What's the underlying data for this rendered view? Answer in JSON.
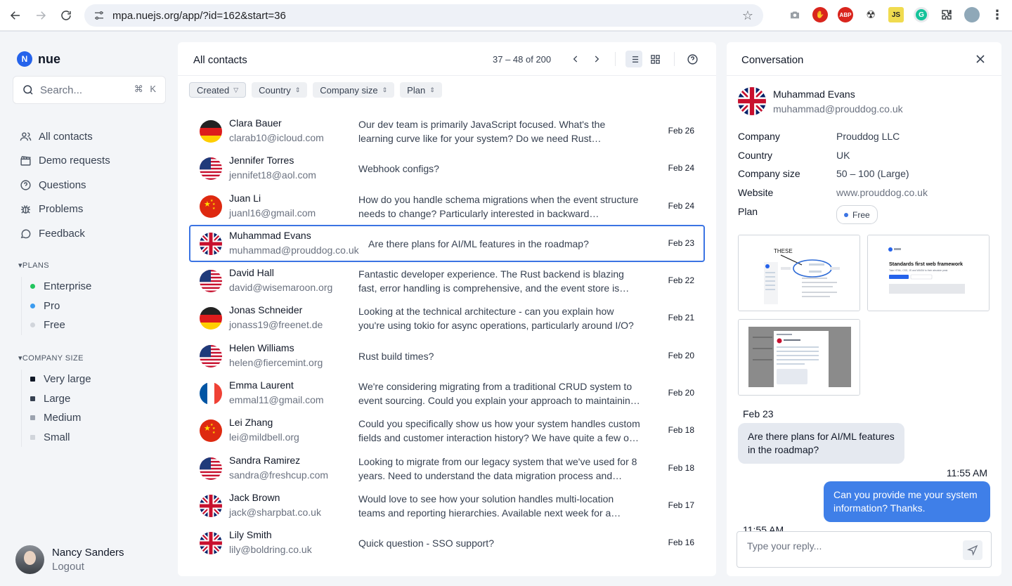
{
  "browser": {
    "url": "mpa.nuejs.org/app/?id=162&start=36"
  },
  "app": {
    "brand": "nue",
    "brand_logo_letter": "N",
    "search": {
      "placeholder": "Search...",
      "shortcut": "⌘ K"
    },
    "nav": [
      {
        "label": "All contacts",
        "icon": "users-icon"
      },
      {
        "label": "Demo requests",
        "icon": "clapperboard-icon"
      },
      {
        "label": "Questions",
        "icon": "question-circle-icon"
      },
      {
        "label": "Problems",
        "icon": "bug-icon"
      },
      {
        "label": "Feedback",
        "icon": "chat-bubble-icon"
      }
    ],
    "plans": {
      "title": "PLANS",
      "items": [
        {
          "label": "Enterprise",
          "color": "#22c55e"
        },
        {
          "label": "Pro",
          "color": "#3b9cf0"
        },
        {
          "label": "Free",
          "color": "#d1d5db"
        }
      ]
    },
    "company_size": {
      "title": "COMPANY SIZE",
      "items": [
        {
          "label": "Very large",
          "color": "#111827"
        },
        {
          "label": "Large",
          "color": "#374151"
        },
        {
          "label": "Medium",
          "color": "#9ca3af"
        },
        {
          "label": "Small",
          "color": "#d1d5db"
        }
      ]
    },
    "user": {
      "name": "Nancy Sanders",
      "logout": "Logout"
    }
  },
  "list": {
    "title": "All contacts",
    "pager": "37 – 48 of 200",
    "filters": [
      "Created",
      "Country",
      "Company size",
      "Plan"
    ],
    "contacts": [
      {
        "name": "Clara Bauer",
        "email": "clarab10@icloud.com",
        "flag": "de",
        "message": "Our dev team is primarily JavaScript focused. What's the learning curve like for your system? Do we need Rust knowledge?",
        "date": "Feb 26"
      },
      {
        "name": "Jennifer Torres",
        "email": "jennifet18@aol.com",
        "flag": "us",
        "message": "Webhook configs?",
        "date": "Feb 24"
      },
      {
        "name": "Juan Li",
        "email": "juanl16@gmail.com",
        "flag": "cn",
        "message": "How do you handle schema migrations when the event structure needs to change? Particularly interested in backward compatibility.",
        "date": "Feb 24"
      },
      {
        "name": "Muhammad Evans",
        "email": "muhammad@prouddog.co.uk",
        "flag": "uk",
        "message": "Are there plans for AI/ML features in the roadmap?",
        "date": "Feb 23",
        "selected": true
      },
      {
        "name": "David Hall",
        "email": "david@wisemaroon.org",
        "flag": "us",
        "message": "Fantastic developer experience. The Rust backend is blazing fast, error handling is comprehensive, and the event store is solid.",
        "date": "Feb 22"
      },
      {
        "name": "Jonas Schneider",
        "email": "jonass19@freenet.de",
        "flag": "de",
        "message": "Looking at the technical architecture - can you explain how you're using tokio for async operations, particularly around I/O?",
        "date": "Feb 21"
      },
      {
        "name": "Helen Williams",
        "email": "helen@fiercemint.org",
        "flag": "us",
        "message": "Rust build times?",
        "date": "Feb 20"
      },
      {
        "name": "Emma Laurent",
        "email": "emmal11@gmail.com",
        "flag": "fr",
        "message": "We're considering migrating from a traditional CRUD system to event sourcing. Could you explain your approach to maintaining consistency?",
        "date": "Feb 20"
      },
      {
        "name": "Lei Zhang",
        "email": "lei@mildbell.org",
        "flag": "cn",
        "message": "Could you specifically show us how your system handles custom fields and customer interaction history? We have quite a few of those.",
        "date": "Feb 18"
      },
      {
        "name": "Sandra Ramirez",
        "email": "sandra@freshcup.com",
        "flag": "us",
        "message": "Looking to migrate from our legacy system that we've used for 8 years. Need to understand the data migration process and timeline.",
        "date": "Feb 18"
      },
      {
        "name": "Jack Brown",
        "email": "jack@sharpbat.co.uk",
        "flag": "uk",
        "message": "Would love to see how your solution handles multi-location teams and reporting hierarchies. Available next week for a demo.",
        "date": "Feb 17"
      },
      {
        "name": "Lily Smith",
        "email": "lily@boldring.co.uk",
        "flag": "uk",
        "message": "Quick question - SSO support?",
        "date": "Feb 16"
      }
    ]
  },
  "conversation": {
    "title": "Conversation",
    "contact": {
      "name": "Muhammad Evans",
      "email": "muhammad@prouddog.co.uk",
      "flag": "uk"
    },
    "props": [
      {
        "key": "Company",
        "value": "Prouddog LLC"
      },
      {
        "key": "Country",
        "value": "UK"
      },
      {
        "key": "Company size",
        "value": "50 – 100 (Large)"
      },
      {
        "key": "Website",
        "value": "www.prouddog.co.uk",
        "link": true
      },
      {
        "key": "Plan",
        "value": "Free",
        "badge": true,
        "badge_color": "#3b74e3"
      }
    ],
    "thumbnails": {
      "t1_label": "THESE",
      "t2_title": "Standards first web framework",
      "t2_sub": "Take HTML, CSS, JS and WASM to their absolute peak"
    },
    "messages": {
      "date": "Feb 23",
      "incoming": "Are there plans for AI/ML features in the roadmap?",
      "time": "11:55 AM",
      "outgoing": "Can you provide me your system information? Thanks.",
      "time2": "11:55 AM"
    },
    "reply_placeholder": "Type your reply..."
  }
}
